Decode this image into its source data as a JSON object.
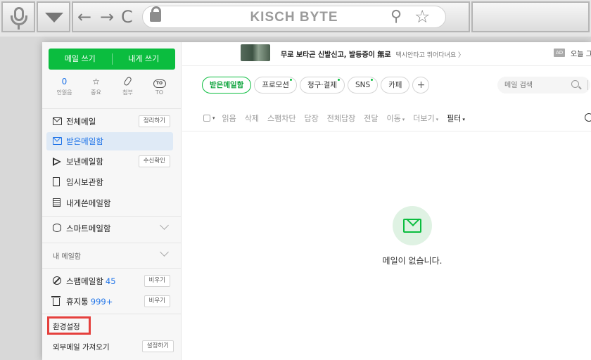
{
  "browser": {
    "brand": "KISCH BYTE",
    "back_icon": "←",
    "forward_icon": "→",
    "reload_icon": "C",
    "zoom_icon": "⚲",
    "star_icon": "☆"
  },
  "sidebar": {
    "compose_label": "메일 쓰기",
    "self_compose_label": "내게 쓰기",
    "quick": {
      "unread_count": "0",
      "unread_label": "안읽음",
      "important_icon": "☆",
      "important_label": "중요",
      "attachment_label": "첨부",
      "to_icon": "TO",
      "to_label": "TO"
    },
    "folders": [
      {
        "label": "전체메일",
        "button": "정리하기"
      },
      {
        "label": "받은메일함"
      },
      {
        "label": "보낸메일함",
        "button": "수신확인"
      },
      {
        "label": "임시보관함"
      },
      {
        "label": "내게쓴메일함"
      }
    ],
    "smart_mailbox": "스마트메일함",
    "my_mailbox": "내 메일함",
    "spam": {
      "label": "스팸메일함",
      "count": "45",
      "button": "비우기"
    },
    "trash": {
      "label": "휴지통",
      "count": "999+",
      "button": "비우기"
    },
    "settings": "환경설정",
    "external": {
      "label": "외부메일 가져오기",
      "button": "설정하기"
    }
  },
  "ad": {
    "text": "무로 보타곤 신발신고, 발등증이 無로",
    "sub": "택시안타고 뛰어다녀요  〉",
    "badge": "AD",
    "right": "오늘 그"
  },
  "tabs": [
    {
      "label": "받은메일함",
      "active": true
    },
    {
      "label": "프로모션",
      "dot": true
    },
    {
      "label": "청구·결제",
      "dot": true
    },
    {
      "label": "SNS",
      "dot": true
    },
    {
      "label": "카페"
    },
    {
      "label": "+"
    }
  ],
  "search": {
    "placeholder": "메일 검색"
  },
  "toolbar": {
    "caret": "▾",
    "read": "읽음",
    "delete": "삭제",
    "spam_block": "스팸차단",
    "reply": "답장",
    "reply_all": "전체답장",
    "forward": "전달",
    "move": "이동",
    "more": "더보기",
    "filter": "필터"
  },
  "empty_message": "메일이 없습니다.",
  "colors": {
    "accent": "#0bbd3f",
    "link": "#1e73e8",
    "highlight": "#e5403d"
  }
}
